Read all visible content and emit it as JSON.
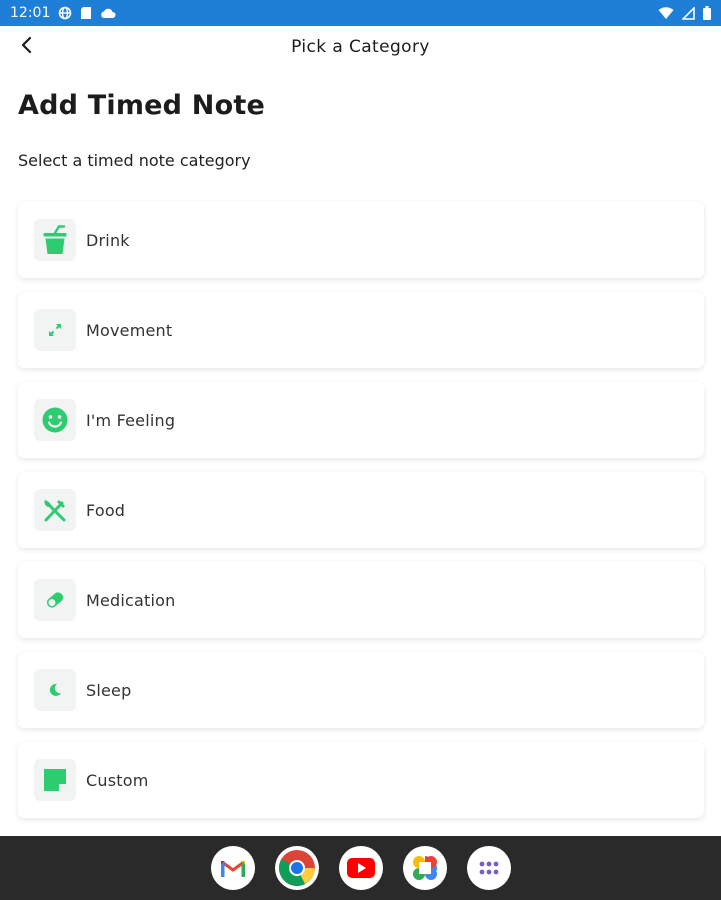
{
  "status_bar": {
    "time": "12:01",
    "left_icons": [
      "vpn-globe-icon",
      "sd-card-icon",
      "cloud-icon"
    ],
    "right_icons": [
      "wifi-icon",
      "cell-signal-icon",
      "battery-icon"
    ]
  },
  "app_bar": {
    "back_icon": "arrow-back-icon",
    "title": "Pick a Category"
  },
  "page": {
    "heading": "Add Timed Note",
    "subheading": "Select a timed note category"
  },
  "categories": [
    {
      "label": "Drink",
      "icon": "cup-icon"
    },
    {
      "label": "Movement",
      "icon": "expand-arrows-icon"
    },
    {
      "label": "I'm Feeling",
      "icon": "smiley-icon"
    },
    {
      "label": "Food",
      "icon": "fork-knife-icon"
    },
    {
      "label": "Medication",
      "icon": "pill-icon"
    },
    {
      "label": "Sleep",
      "icon": "moon-icon"
    },
    {
      "label": "Custom",
      "icon": "sticky-note-icon"
    }
  ],
  "dock": [
    "gmail-icon",
    "chrome-icon",
    "youtube-icon",
    "photos-icon",
    "app-drawer-icon"
  ],
  "colors": {
    "status_bar": "#1f7fd6",
    "accent_green": "#2ecc71",
    "nav_bar": "#2a2a2a"
  }
}
